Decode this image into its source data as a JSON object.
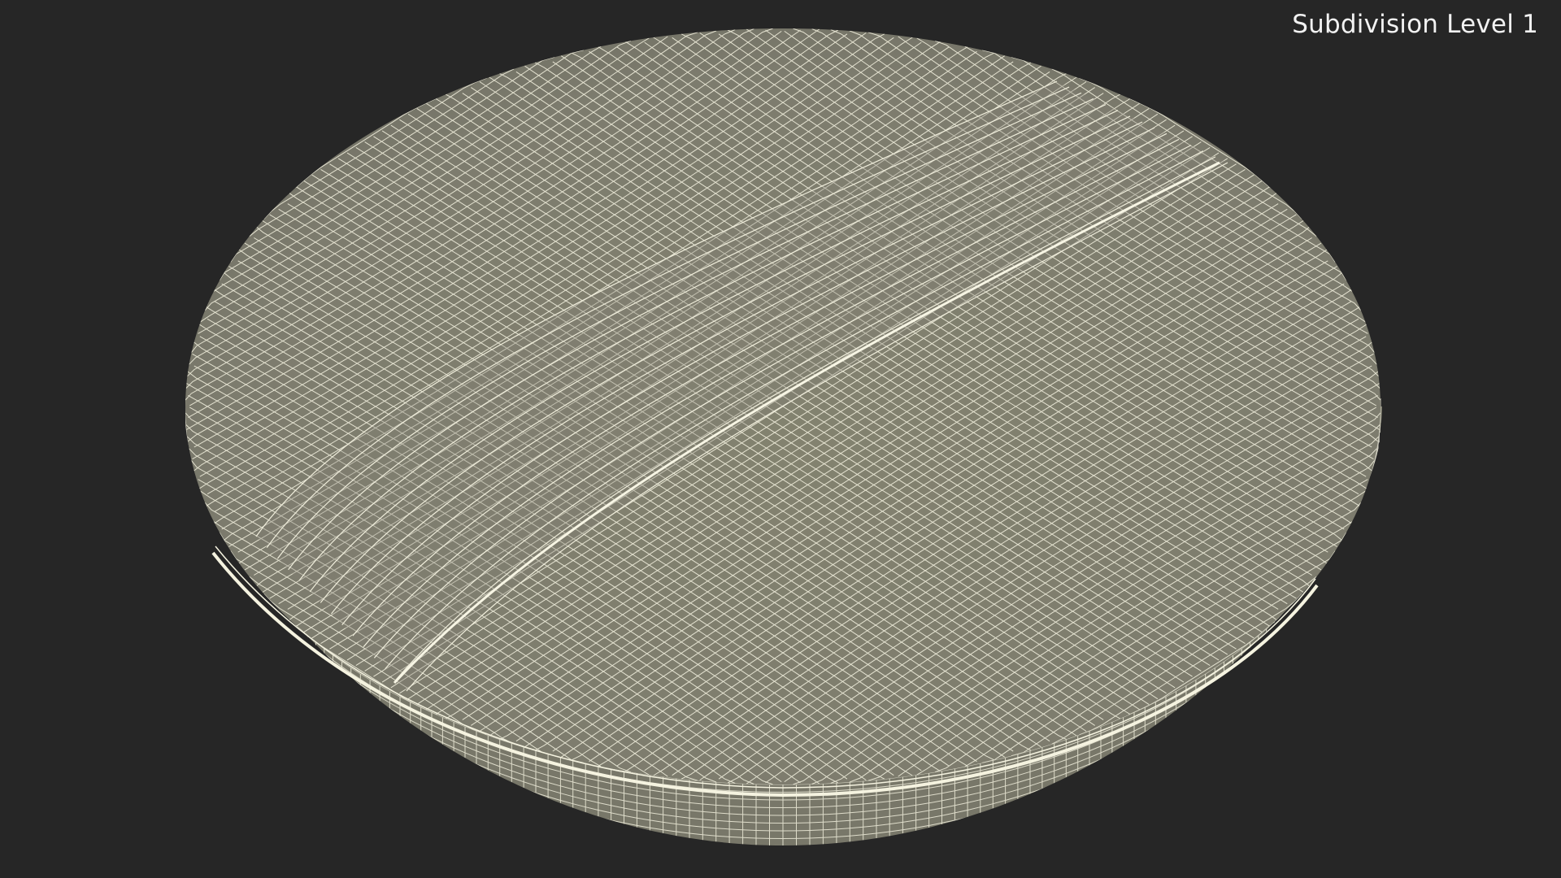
{
  "viewport": {
    "overlay_label": "Subdivision Level 1",
    "background_color": "#262626",
    "model_fill_color": "#7f7e71",
    "wire_color": "#f0eedc"
  }
}
